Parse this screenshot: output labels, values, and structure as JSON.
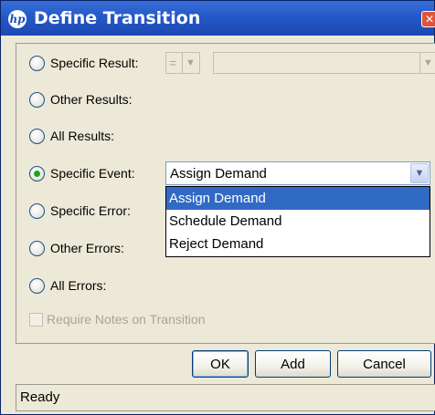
{
  "window": {
    "title": "Define Transition",
    "logo_text": "hp",
    "close_glyph": "✕"
  },
  "options": [
    {
      "label": "Specific Result:",
      "selected": false
    },
    {
      "label": "Other Results:",
      "selected": false
    },
    {
      "label": "All Results:",
      "selected": false
    },
    {
      "label": "Specific Event:",
      "selected": true
    },
    {
      "label": "Specific Error:",
      "selected": false
    },
    {
      "label": "Other Errors:",
      "selected": false
    },
    {
      "label": "All Errors:",
      "selected": false
    }
  ],
  "specific_result": {
    "operator_value": "=",
    "result_value": ""
  },
  "specific_event": {
    "value": "Assign Demand",
    "dropdown_items": [
      "Assign Demand",
      "Schedule Demand",
      "Reject Demand"
    ],
    "highlighted": "Assign Demand"
  },
  "require_notes": {
    "label": "Require Notes on Transition",
    "checked": false,
    "enabled": false
  },
  "buttons": {
    "ok": "OK",
    "add": "Add",
    "cancel": "Cancel"
  },
  "status": {
    "text": "Ready"
  },
  "colors": {
    "title_bar": "#2458c8",
    "selection": "#316ac5",
    "radio_dot": "#21a121"
  }
}
